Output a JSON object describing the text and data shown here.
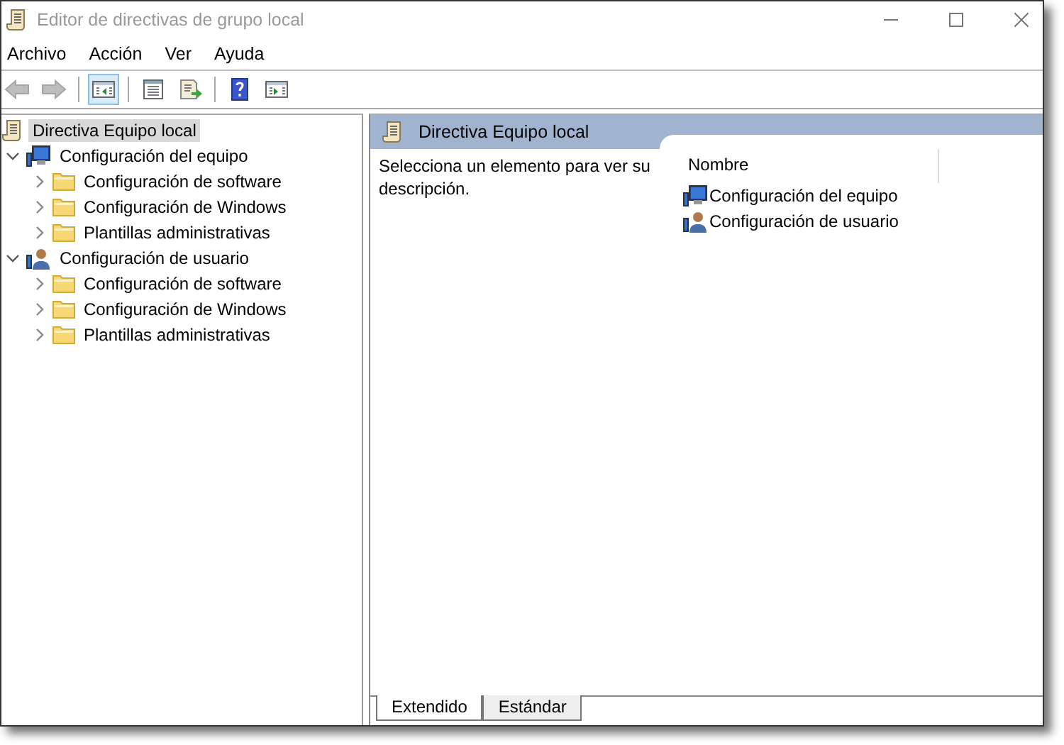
{
  "window": {
    "title": "Editor de directivas de grupo local"
  },
  "menu": [
    "Archivo",
    "Acción",
    "Ver",
    "Ayuda"
  ],
  "toolbar": [
    {
      "kind": "back",
      "disabled": true,
      "selected": false
    },
    {
      "kind": "forward",
      "disabled": true,
      "selected": false
    },
    {
      "kind": "separator"
    },
    {
      "kind": "tree-toggle",
      "disabled": false,
      "selected": true
    },
    {
      "kind": "separator"
    },
    {
      "kind": "properties",
      "disabled": false,
      "selected": false
    },
    {
      "kind": "export",
      "disabled": false,
      "selected": false
    },
    {
      "kind": "separator"
    },
    {
      "kind": "help",
      "disabled": false,
      "selected": false
    },
    {
      "kind": "action-pane",
      "disabled": false,
      "selected": false
    }
  ],
  "tree": {
    "label": "Directiva Equipo local",
    "kind": "policy",
    "selected": true,
    "children": [
      {
        "label": "Configuración del equipo",
        "kind": "computer",
        "selected": false,
        "expanded": true,
        "children": [
          {
            "label": "Configuración de software",
            "kind": "folder",
            "selected": false,
            "expanded": false
          },
          {
            "label": "Configuración de Windows",
            "kind": "folder",
            "selected": false,
            "expanded": false
          },
          {
            "label": "Plantillas administrativas",
            "kind": "folder",
            "selected": false,
            "expanded": false
          }
        ]
      },
      {
        "label": "Configuración de usuario",
        "kind": "user",
        "selected": false,
        "expanded": true,
        "children": [
          {
            "label": "Configuración de software",
            "kind": "folder",
            "selected": false,
            "expanded": false
          },
          {
            "label": "Configuración de Windows",
            "kind": "folder",
            "selected": false,
            "expanded": false
          },
          {
            "label": "Plantillas administrativas",
            "kind": "folder",
            "selected": false,
            "expanded": false
          }
        ]
      }
    ]
  },
  "details": {
    "header": "Directiva Equipo local",
    "description": "Selecciona un elemento para ver su descripción.",
    "column": "Nombre",
    "items": [
      {
        "label": "Configuración del equipo",
        "kind": "computer"
      },
      {
        "label": "Configuración de usuario",
        "kind": "user"
      }
    ]
  },
  "tabs": [
    {
      "label": "Extendido",
      "selected": true
    },
    {
      "label": "Estándar",
      "selected": false
    }
  ]
}
